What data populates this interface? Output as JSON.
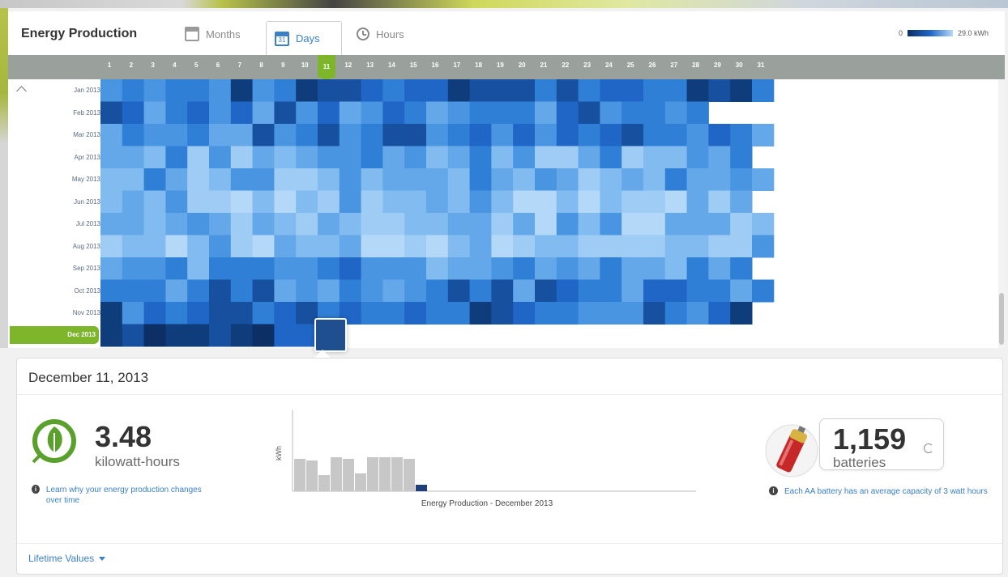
{
  "header": {
    "title": "Energy Production",
    "tabs": [
      {
        "label": "Months",
        "icon": "calendar-icon"
      },
      {
        "label": "Days",
        "icon": "calendar-icon",
        "active": true,
        "icon_text": "31"
      },
      {
        "label": "Hours",
        "icon": "clock-icon"
      }
    ],
    "legend": {
      "min": "0",
      "max": "29.0 kWh"
    }
  },
  "days": [
    "1",
    "2",
    "3",
    "4",
    "5",
    "6",
    "7",
    "8",
    "9",
    "10",
    "11",
    "12",
    "13",
    "14",
    "15",
    "16",
    "17",
    "18",
    "19",
    "20",
    "21",
    "22",
    "23",
    "24",
    "25",
    "26",
    "27",
    "28",
    "29",
    "30",
    "31"
  ],
  "selected_day": "11",
  "months": [
    "Jan 2013",
    "Feb 2013",
    "Mar 2013",
    "Apr 2013",
    "May 2013",
    "Jun 2013",
    "Jul 2013",
    "Aug 2013",
    "Sep 2013",
    "Oct 2013",
    "Nov 2013",
    "Dec 2013"
  ],
  "selected_month": "Dec 2013",
  "heatmap_colors": {
    "low": "#b4d8f7",
    "high": "#0c2f66"
  },
  "detail": {
    "date": "December 11, 2013",
    "value": "3.48",
    "unit": "kilowatt-hours",
    "learn_text": "Learn why your energy production changes over time",
    "chart_ylabel": "kWh",
    "chart_title": "Energy Production - December 2013",
    "batteries_value": "1,159",
    "batteries_unit": "batteries",
    "battery_note": "Each AA battery has an average capacity of 3 watt hours",
    "lifetime_label": "Lifetime Values"
  }
}
